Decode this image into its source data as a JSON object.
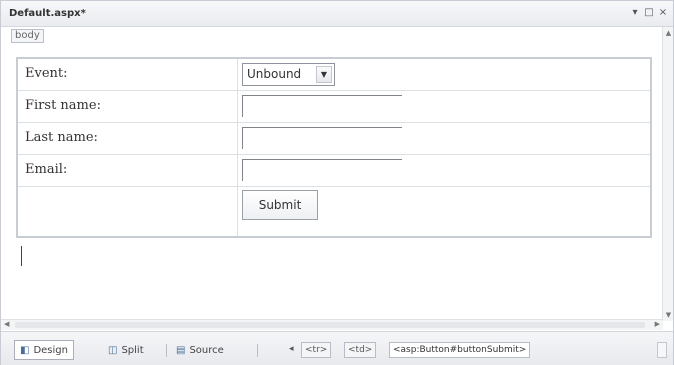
{
  "window": {
    "title": "Default.aspx*",
    "controls": {
      "minimize": "▾",
      "restore": "□",
      "close": "×"
    }
  },
  "editor": {
    "tag_crumb": "body",
    "form": {
      "rows": [
        {
          "label": "Event:",
          "control": "select",
          "value": "Unbound"
        },
        {
          "label": "First name:",
          "control": "textbox",
          "value": ""
        },
        {
          "label": "Last name:",
          "control": "textbox",
          "value": ""
        },
        {
          "label": "Email:",
          "control": "textbox",
          "value": ""
        }
      ],
      "submit_label": "Submit"
    }
  },
  "statusbar": {
    "tabs": [
      {
        "label": "Design",
        "icon": "design-view-icon",
        "glyph": "◧",
        "active": true
      },
      {
        "label": "Split",
        "icon": "split-view-icon",
        "glyph": "◫",
        "active": false
      },
      {
        "label": "Source",
        "icon": "source-view-icon",
        "glyph": "▤",
        "active": false
      }
    ],
    "nav_arrow": "◂",
    "tag_path": [
      "<tr>",
      "<td>",
      "<asp:Button#buttonSubmit>"
    ]
  }
}
